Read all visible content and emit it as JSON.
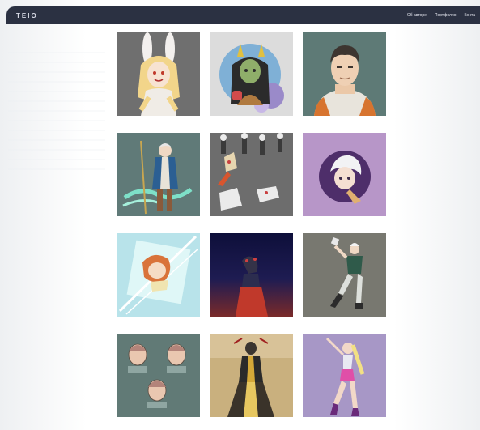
{
  "header": {
    "logo": "TEIO",
    "nav": [
      {
        "label": "Об авторе"
      },
      {
        "label": "Портфолио"
      },
      {
        "label": "Конта"
      }
    ]
  },
  "gallery": {
    "items": [
      {
        "name": "bunny-girl-artwork",
        "bg": "#6f6f6f"
      },
      {
        "name": "horned-girl-artwork",
        "bg": "#dcdcdc"
      },
      {
        "name": "astronaut-man-artwork",
        "bg": "#5e7a76"
      },
      {
        "name": "blue-coat-warrior-artwork",
        "bg": "#607a78"
      },
      {
        "name": "character-poses-sheet-artwork",
        "bg": "#6d6d6d"
      },
      {
        "name": "white-hair-purple-circle-artwork",
        "bg": "#b796c8"
      },
      {
        "name": "redhead-light-frame-artwork",
        "bg": "#b8e3ea"
      },
      {
        "name": "red-skirt-night-artwork",
        "bg": "#1c1a4a"
      },
      {
        "name": "green-jacket-pose-artwork",
        "bg": "#787870"
      },
      {
        "name": "face-studies-artwork",
        "bg": "#617a76"
      },
      {
        "name": "black-gold-figure-artwork",
        "bg": "#c9b07e"
      },
      {
        "name": "pink-dancer-artwork",
        "bg": "#a797c6"
      }
    ]
  }
}
